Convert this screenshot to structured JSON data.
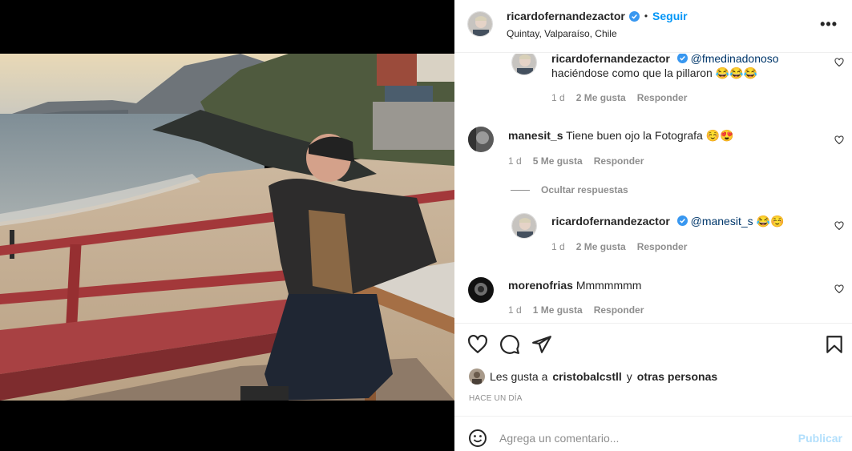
{
  "post": {
    "author": "ricardofernandezactor",
    "location": "Quintay, Valparaíso, Chile",
    "follow_label": "Seguir",
    "more_label": "•••"
  },
  "comments": [
    {
      "user": "ricardofernandezactor",
      "mention": "@fmedinadonoso",
      "text": "haciéndose como que la pillaron 😂😂😂",
      "age": "1 d",
      "likes": "2 Me gusta",
      "reply": "Responder"
    },
    {
      "user": "manesit_s",
      "text": "Tiene buen ojo la Fotografa ☺️😍",
      "age": "1 d",
      "likes": "5 Me gusta",
      "reply": "Responder"
    },
    {
      "user": "ricardofernandezactor",
      "mention": "@manesit_s",
      "text": "😂☺️",
      "age": "1 d",
      "likes": "2 Me gusta",
      "reply": "Responder"
    },
    {
      "user": "morenofrias",
      "text": "Mmmmmmm",
      "age": "1 d",
      "likes": "1 Me gusta",
      "reply": "Responder"
    }
  ],
  "hide_replies": "Ocultar respuestas",
  "likes_line": {
    "prefix": "Les gusta a",
    "user": "cristobalcstll",
    "mid": "y",
    "others": "otras personas"
  },
  "time_ago": "HACE UN DÍA",
  "composer": {
    "placeholder": "Agrega un comentario...",
    "publish": "Publicar"
  },
  "icons": {
    "like": "heart-icon",
    "comment": "comment-icon",
    "share": "share-icon",
    "save": "bookmark-icon",
    "emoji": "emoji-icon",
    "verified": "verified-badge-icon"
  },
  "colors": {
    "accent": "#0095f6",
    "verified": "#3897f0",
    "link": "#00376b",
    "muted": "#8e8e8e",
    "publish_disabled": "#b2dffc"
  }
}
